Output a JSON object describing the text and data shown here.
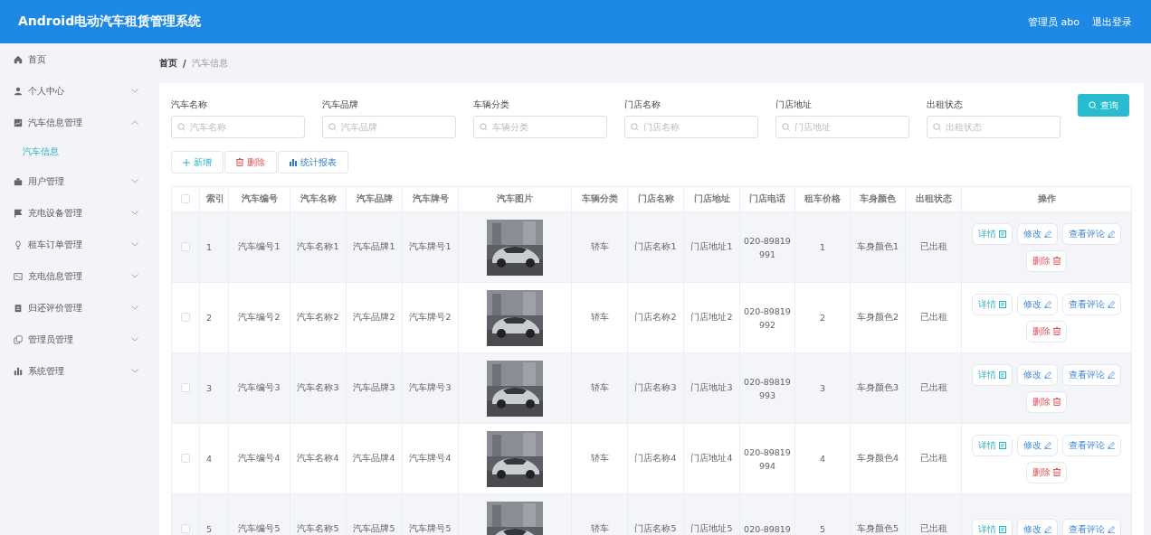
{
  "header": {
    "title": "Android电动汽车租赁管理系统",
    "user": "管理员 abo",
    "logout": "退出登录"
  },
  "sidebar": {
    "items": [
      {
        "label": "首页"
      },
      {
        "label": "个人中心",
        "expandable": true,
        "expanded": false
      },
      {
        "label": "汽车信息管理",
        "expandable": true,
        "expanded": true,
        "children": [
          {
            "label": "汽车信息",
            "selected": true
          }
        ]
      },
      {
        "label": "用户管理",
        "expandable": true,
        "expanded": false
      },
      {
        "label": "充电设备管理",
        "expandable": true,
        "expanded": false
      },
      {
        "label": "租车订单管理",
        "expandable": true,
        "expanded": false
      },
      {
        "label": "充电信息管理",
        "expandable": true,
        "expanded": false
      },
      {
        "label": "归还评价管理",
        "expandable": true,
        "expanded": false
      },
      {
        "label": "管理员管理",
        "expandable": true,
        "expanded": false
      },
      {
        "label": "系统管理",
        "expandable": true,
        "expanded": false
      }
    ]
  },
  "breadcrumb": [
    "首页",
    "/",
    "汽车信息"
  ],
  "search": {
    "fields": [
      {
        "label": "汽车名称",
        "placeholder": "汽车名称"
      },
      {
        "label": "汽车品牌",
        "placeholder": "汽车品牌"
      },
      {
        "label": "车辆分类",
        "placeholder": "车辆分类"
      },
      {
        "label": "门店名称",
        "placeholder": "门店名称"
      },
      {
        "label": "门店地址",
        "placeholder": "门店地址"
      },
      {
        "label": "出租状态",
        "placeholder": "出租状态"
      }
    ],
    "button": "查询"
  },
  "toolbar": [
    {
      "kind": "add",
      "label": "新增"
    },
    {
      "kind": "delete",
      "label": "删除"
    },
    {
      "kind": "report",
      "label": "统计报表"
    }
  ],
  "table": {
    "header_checked": false,
    "columns": [
      "索引",
      "汽车编号",
      "汽车名称",
      "汽车品牌",
      "汽车牌号",
      "汽车图片",
      "车辆分类",
      "门店名称",
      "门店地址",
      "门店电话",
      "租车价格",
      "车身颜色",
      "出租状态",
      "操作"
    ],
    "rows": [
      {
        "checked": false,
        "cells": [
          "1",
          "汽车编号1",
          "汽车名称1",
          "汽车品牌1",
          "汽车牌号1"
        ],
        "image": {
          "kind": "picture"
        },
        "cells2": [
          "轿车",
          "门店名称1",
          "门店地址1"
        ],
        "phone": [
          "020-89819",
          "991"
        ],
        "cells3": [
          "1",
          "车身颜色1",
          "已出租"
        ],
        "actions": [
          {
            "kind": "detail",
            "label": "详情"
          },
          {
            "kind": "edit",
            "label": "修改"
          },
          {
            "kind": "comment",
            "label": "查看评论"
          },
          {
            "kind": "delete",
            "label": "删除"
          }
        ]
      },
      {
        "checked": false,
        "cells": [
          "2",
          "汽车编号2",
          "汽车名称2",
          "汽车品牌2",
          "汽车牌号2"
        ],
        "image": {
          "kind": "picture"
        },
        "cells2": [
          "轿车",
          "门店名称2",
          "门店地址2"
        ],
        "phone": [
          "020-89819",
          "992"
        ],
        "cells3": [
          "2",
          "车身颜色2",
          "已出租"
        ],
        "actions": [
          {
            "kind": "detail",
            "label": "详情"
          },
          {
            "kind": "edit",
            "label": "修改"
          },
          {
            "kind": "comment",
            "label": "查看评论"
          },
          {
            "kind": "delete",
            "label": "删除"
          }
        ]
      },
      {
        "checked": false,
        "cells": [
          "3",
          "汽车编号3",
          "汽车名称3",
          "汽车品牌3",
          "汽车牌号3"
        ],
        "image": {
          "kind": "picture"
        },
        "cells2": [
          "轿车",
          "门店名称3",
          "门店地址3"
        ],
        "phone": [
          "020-89819",
          "993"
        ],
        "cells3": [
          "3",
          "车身颜色3",
          "已出租"
        ],
        "actions": [
          {
            "kind": "detail",
            "label": "详情"
          },
          {
            "kind": "edit",
            "label": "修改"
          },
          {
            "kind": "comment",
            "label": "查看评论"
          },
          {
            "kind": "delete",
            "label": "删除"
          }
        ]
      },
      {
        "checked": false,
        "cells": [
          "4",
          "汽车编号4",
          "汽车名称4",
          "汽车品牌4",
          "汽车牌号4"
        ],
        "image": {
          "kind": "picture"
        },
        "cells2": [
          "轿车",
          "门店名称4",
          "门店地址4"
        ],
        "phone": [
          "020-89819",
          "994"
        ],
        "cells3": [
          "4",
          "车身颜色4",
          "已出租"
        ],
        "actions": [
          {
            "kind": "detail",
            "label": "详情"
          },
          {
            "kind": "edit",
            "label": "修改"
          },
          {
            "kind": "comment",
            "label": "查看评论"
          },
          {
            "kind": "delete",
            "label": "删除"
          }
        ]
      },
      {
        "checked": false,
        "cells": [
          "5",
          "汽车编号5",
          "汽车名称5",
          "汽车品牌5",
          "汽车牌号5"
        ],
        "image": {
          "kind": "picture"
        },
        "cells2": [
          "轿车",
          "门店名称5",
          "门店地址5"
        ],
        "phone": [
          "020-89819"
        ],
        "cells3": [
          "5",
          "车身颜色5",
          "已出租"
        ],
        "actions": [
          {
            "kind": "detail",
            "label": "详情"
          },
          {
            "kind": "edit",
            "label": "修改"
          },
          {
            "kind": "comment",
            "label": "查看评论"
          }
        ]
      }
    ]
  }
}
